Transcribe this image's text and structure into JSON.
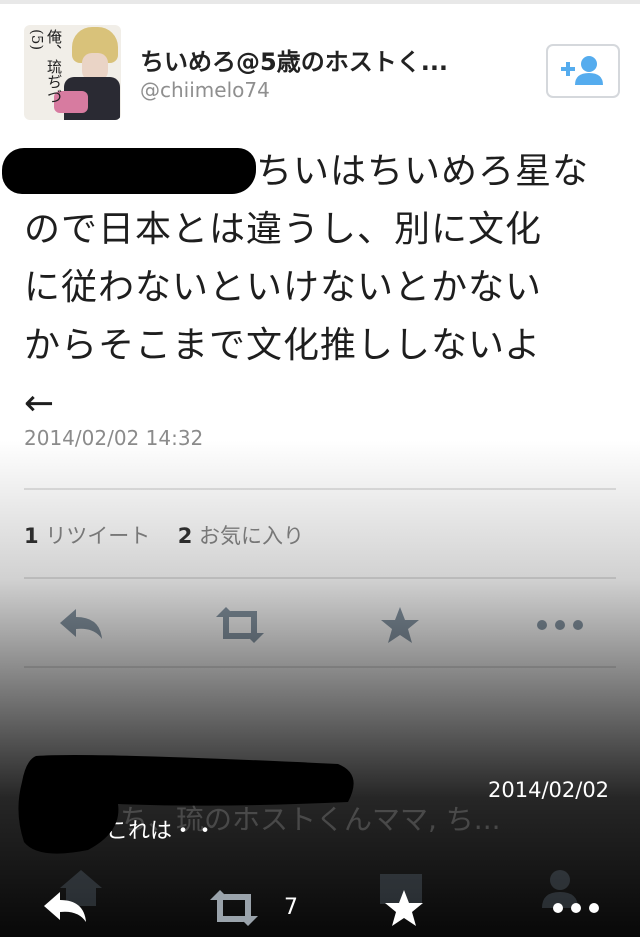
{
  "user": {
    "display_name": "ちいめろ@5歳のホストく...",
    "handle": "@chiimelo74",
    "avatar_text": "俺、琉ぢづ(5)"
  },
  "follow_button": {
    "icon": "add-user-icon"
  },
  "tweet": {
    "line1": "ちいはちいめろ星な",
    "line2": "ので日本とは違うし、別に文化",
    "line3": "に従わないといけないとかない",
    "line4": "からそこまで文化推ししないよ",
    "line5": "←",
    "timestamp": "2014/02/02 14:32"
  },
  "stats": {
    "retweet_count": "1",
    "retweet_label": "リツイート",
    "favorite_count": "2",
    "favorite_label": "お気に入り"
  },
  "actions": [
    "reply-icon",
    "retweet-icon",
    "favorite-star-icon",
    "more-dots-icon"
  ],
  "quoted": {
    "ghost_text": "ち、琉のホストくんママ, ち...",
    "text": "これは・・",
    "date": "2014/02/02"
  },
  "bottom_bar": {
    "actions": [
      "reply-icon",
      "retweet-icon",
      "favorite-star-icon",
      "more-dots-icon"
    ],
    "retweet_count": "7"
  },
  "colors": {
    "text": "#1e1e1e",
    "muted": "#8b8b8b",
    "accent_blue": "#55acee",
    "icon_grey": "#8a9aa8"
  }
}
